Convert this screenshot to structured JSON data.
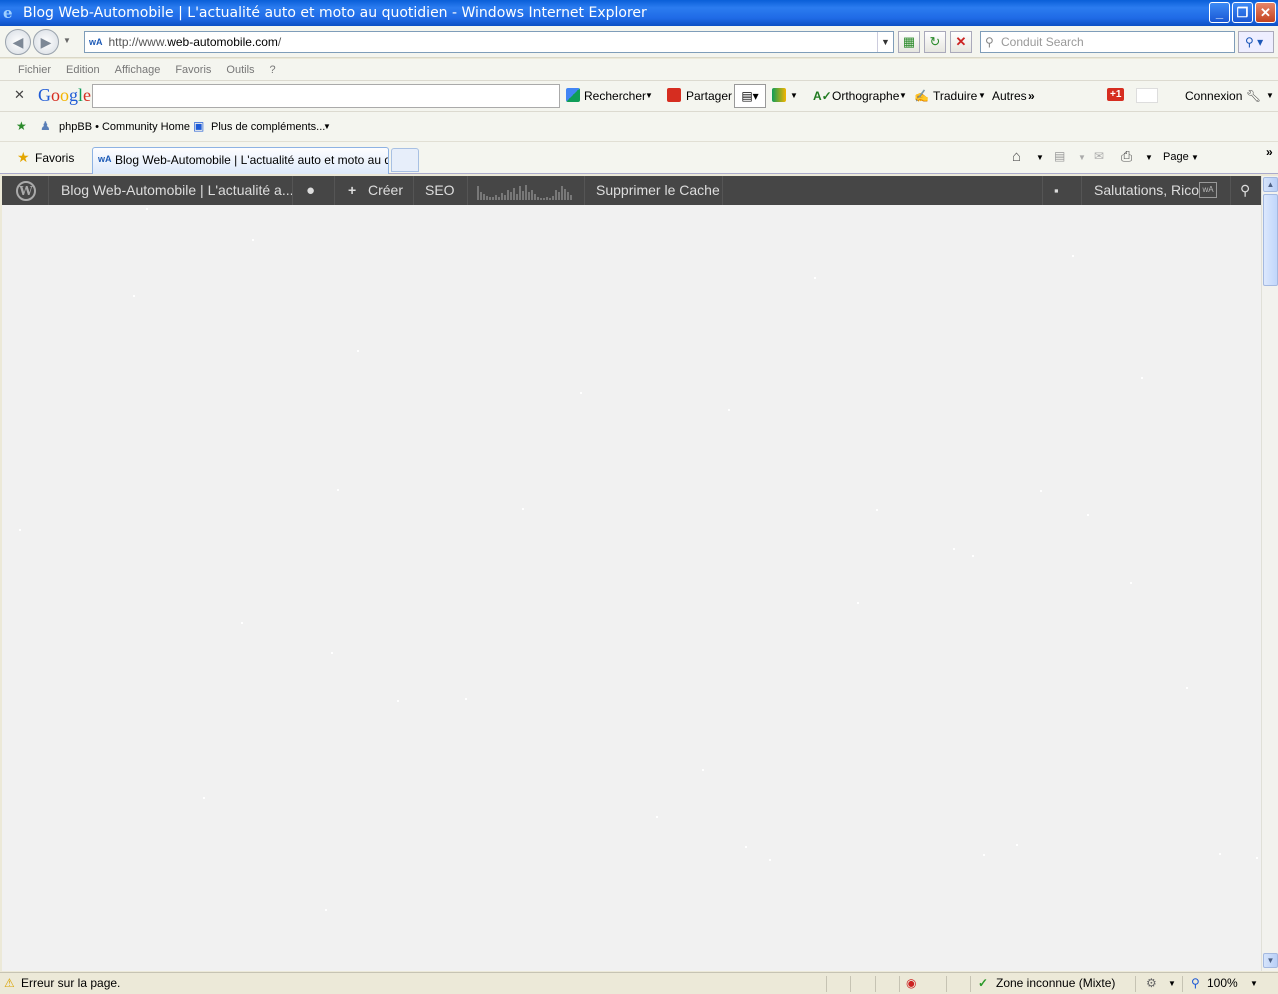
{
  "window": {
    "title": "Blog Web-Automobile | L'actualité auto et moto au quotidien - Windows Internet Explorer",
    "minimize": "_",
    "restore": "❐",
    "close": "✕"
  },
  "address": {
    "prefix": "http://www.",
    "host": "web-automobile.com",
    "suffix": "/"
  },
  "search": {
    "placeholder": "Conduit Search"
  },
  "menu": [
    "Fichier",
    "Edition",
    "Affichage",
    "Favoris",
    "Outils",
    "?"
  ],
  "google_toolbar": {
    "logo": "Google",
    "search": "Rechercher",
    "share": "Partager",
    "spelling": "Orthographe",
    "translate": "Traduire",
    "more": "Autres",
    "gplus": "+1",
    "login": "Connexion"
  },
  "links": {
    "phpbb": "phpBB • Community Home",
    "addons": "Plus de compléments..."
  },
  "tabs": {
    "favorites": "Favoris",
    "active": "Blog Web-Automobile | L'actualité auto et moto au qu...",
    "page_menu": "Page"
  },
  "wp_admin": {
    "site": "Blog Web-Automobile | L'actualité a...",
    "create": "Créer",
    "seo": "SEO",
    "clear_cache": "Supprimer le Cache",
    "greeting": "Salutations, Rico"
  },
  "status": {
    "message": "Erreur sur la page.",
    "zone": "Zone inconnue (Mixte)",
    "zoom": "100%"
  },
  "colors": {
    "wp_admin_bg": "#464646",
    "content_bg": "#f1f1f1",
    "titlebar": "#1f6ae6"
  }
}
